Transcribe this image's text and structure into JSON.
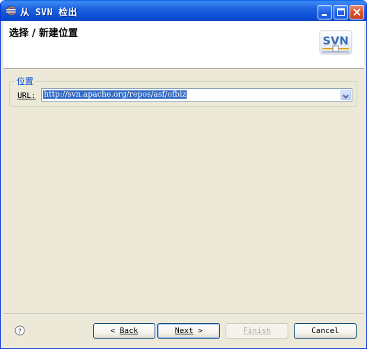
{
  "window": {
    "title": "从 SVN 检出",
    "controls": [
      "minimize-icon",
      "maximize-icon",
      "close-icon"
    ]
  },
  "banner": {
    "title": "选择 / 新建位置",
    "logo_text": "SVN"
  },
  "location_group": {
    "legend": "位置",
    "url_label": "URL:",
    "url_value": "http://svn.apache.org/repos/asf/ofbiz"
  },
  "buttons": {
    "back_arrow": "<",
    "back": "Back",
    "next": "Next",
    "next_arrow": ">",
    "finish": "Finish",
    "cancel": "Cancel"
  },
  "colors": {
    "titlebar": "#0b4fd3",
    "dialog_bg": "#ece9d8",
    "selection": "#316ac5",
    "legend": "#0046d5"
  }
}
